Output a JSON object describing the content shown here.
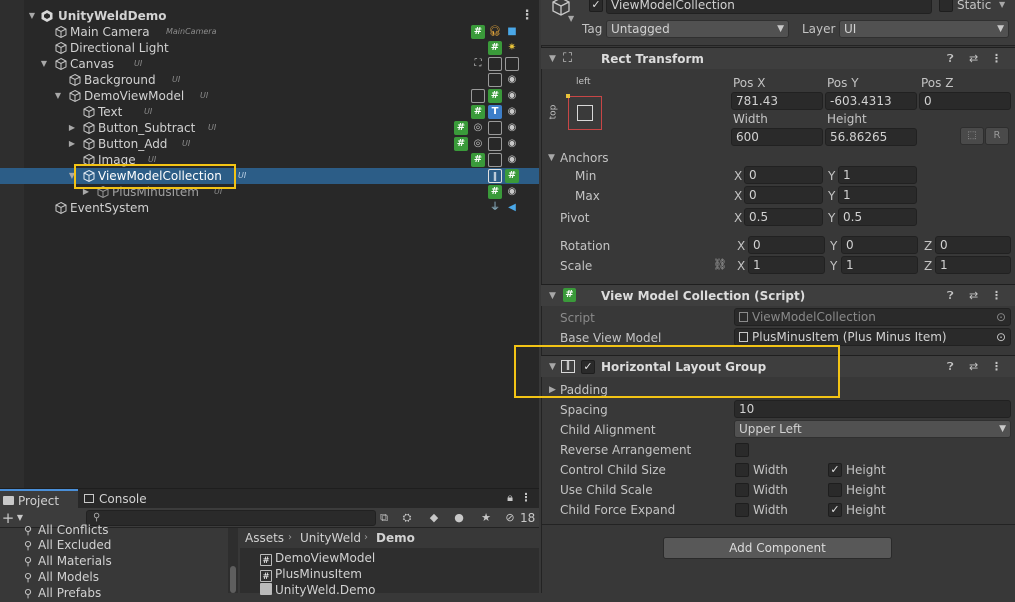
{
  "hierarchy": {
    "scene_name": "UnityWeldDemo",
    "items": [
      {
        "name": "Main Camera",
        "tag": "MainCamera"
      },
      {
        "name": "Directional Light",
        "tag": ""
      },
      {
        "name": "Canvas",
        "tag": "UI"
      },
      {
        "name": "Background",
        "tag": "UI"
      },
      {
        "name": "DemoViewModel",
        "tag": "UI"
      },
      {
        "name": "Text",
        "tag": "UI"
      },
      {
        "name": "Button_Subtract",
        "tag": "UI"
      },
      {
        "name": "Button_Add",
        "tag": "UI"
      },
      {
        "name": "Image",
        "tag": "UI"
      },
      {
        "name": "ViewModelCollection",
        "tag": "UI"
      },
      {
        "name": "PlusMinusItem",
        "tag": "UI"
      },
      {
        "name": "EventSystem",
        "tag": ""
      }
    ]
  },
  "project": {
    "tabs": [
      "Project",
      "Console"
    ],
    "hidden_count": "18",
    "favorites": [
      "All Conflicts",
      "All Excluded",
      "All Materials",
      "All Models",
      "All Prefabs"
    ],
    "breadcrumb": [
      "Assets",
      "UnityWeld",
      "Demo"
    ],
    "assets": [
      "DemoViewModel",
      "PlusMinusItem",
      "UnityWeld.Demo"
    ]
  },
  "inspector": {
    "object_name": "ViewModelCollection",
    "static_label": "Static",
    "tag_label": "Tag",
    "tag_value": "Untagged",
    "layer_label": "Layer",
    "layer_value": "UI",
    "rect_transform": {
      "title": "Rect Transform",
      "anchor_h": "left",
      "anchor_v": "top",
      "pos_x_label": "Pos X",
      "pos_x": "781.43",
      "pos_y_label": "Pos Y",
      "pos_y": "-603.4313",
      "pos_z_label": "Pos Z",
      "pos_z": "0",
      "width_label": "Width",
      "width": "600",
      "height_label": "Height",
      "height": "56.86265",
      "raw_label": "R",
      "anchors_label": "Anchors",
      "min_label": "Min",
      "min_x": "0",
      "min_y": "1",
      "max_label": "Max",
      "max_x": "0",
      "max_y": "1",
      "pivot_label": "Pivot",
      "pivot_x": "0.5",
      "pivot_y": "0.5",
      "rotation_label": "Rotation",
      "rot_x": "0",
      "rot_y": "0",
      "rot_z": "0",
      "scale_label": "Scale",
      "scale_x": "1",
      "scale_y": "1",
      "scale_z": "1",
      "x": "X",
      "y": "Y",
      "z": "Z"
    },
    "view_model_collection": {
      "title": "View Model Collection (Script)",
      "script_label": "Script",
      "script_value": "ViewModelCollection",
      "base_vm_label": "Base View Model",
      "base_vm_value": "PlusMinusItem (Plus Minus Item)"
    },
    "horizontal_layout": {
      "title": "Horizontal Layout Group",
      "padding_label": "Padding",
      "spacing_label": "Spacing",
      "spacing": "10",
      "child_alignment_label": "Child Alignment",
      "child_alignment": "Upper Left",
      "reverse_label": "Reverse Arrangement",
      "control_size_label": "Control Child Size",
      "use_scale_label": "Use Child Scale",
      "force_expand_label": "Child Force Expand",
      "width_label": "Width",
      "height_label": "Height",
      "control_width": false,
      "control_height": true,
      "scale_width": false,
      "scale_height": false,
      "expand_width": false,
      "expand_height": true
    },
    "add_component": "Add Component"
  }
}
